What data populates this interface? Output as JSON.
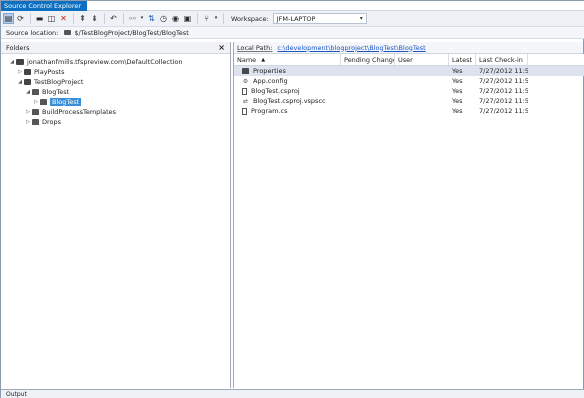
{
  "window": {
    "tab_title": "Source Control Explorer",
    "pin_glyph": "⊐",
    "close_glyph": "✕"
  },
  "toolbar": {
    "workspace_label": "Workspace:",
    "workspace_value": "JFM-LAPTOP"
  },
  "source_location": {
    "label": "Source location:",
    "path": "$/TestBlogProject/BlogTest/BlogTest"
  },
  "folders_pane": {
    "header": "Folders",
    "close_glyph": "×",
    "tree": [
      {
        "label": "jonathanfmills.tfspreview.com\\DefaultCollection",
        "depth": 0,
        "expanded": true,
        "icon": "collection-icon"
      },
      {
        "label": "PlayPosts",
        "depth": 1,
        "expanded": false,
        "icon": "team-project-icon"
      },
      {
        "label": "TestBlogProject",
        "depth": 1,
        "expanded": true,
        "icon": "team-project-icon"
      },
      {
        "label": "BlogTest",
        "depth": 2,
        "expanded": true,
        "icon": "folder-icon"
      },
      {
        "label": "BlogTest",
        "depth": 3,
        "expanded": false,
        "icon": "folder-icon",
        "selected": true
      },
      {
        "label": "BuildProcessTemplates",
        "depth": 2,
        "expanded": false,
        "icon": "folder-icon"
      },
      {
        "label": "Drops",
        "depth": 2,
        "expanded": false,
        "icon": "folder-icon"
      }
    ]
  },
  "items_pane": {
    "local_path_label": "Local Path:",
    "local_path": "c:\\development\\blogproject\\BlogTest\\BlogTest",
    "columns": [
      "Name",
      "Pending Change",
      "User",
      "Latest",
      "Last Check-in"
    ],
    "rows": [
      {
        "name": "Properties",
        "pending": "",
        "user": "",
        "latest": "Yes",
        "checkin": "7/27/2012 11:5...",
        "icon": "folder-icon",
        "selected": true
      },
      {
        "name": "App.config",
        "pending": "",
        "user": "",
        "latest": "Yes",
        "checkin": "7/27/2012 11:5...",
        "icon": "config-file-icon"
      },
      {
        "name": "BlogTest.csproj",
        "pending": "",
        "user": "",
        "latest": "Yes",
        "checkin": "7/27/2012 11:5...",
        "icon": "csproj-file-icon"
      },
      {
        "name": "BlogTest.csproj.vspscc",
        "pending": "",
        "user": "",
        "latest": "Yes",
        "checkin": "7/27/2012 11:5...",
        "icon": "vspscc-file-icon"
      },
      {
        "name": "Program.cs",
        "pending": "",
        "user": "",
        "latest": "Yes",
        "checkin": "7/27/2012 11:5...",
        "icon": "cs-file-icon"
      }
    ]
  },
  "bottom_tab": {
    "label": "Output"
  }
}
